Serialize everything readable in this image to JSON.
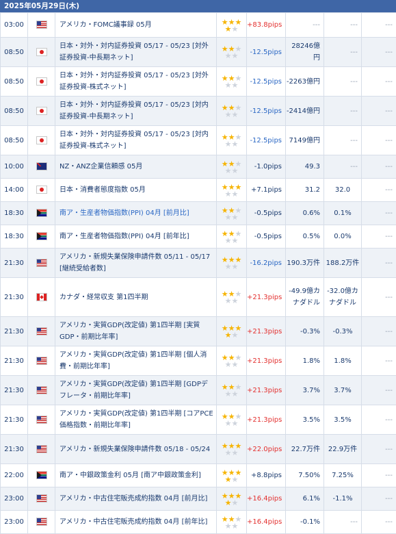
{
  "date_header": "2025年05月29日(木)",
  "rows": [
    {
      "time": "03:00",
      "flag": "us",
      "event": "アメリカ・FOMC議事録 05月",
      "stars": 4,
      "pips": "+83.8pips",
      "pips_class": "pos",
      "prev": "---",
      "forecast": "---",
      "result": "---"
    },
    {
      "time": "08:50",
      "flag": "jp",
      "event": "日本・対外・対内証券投資 05/17 - 05/23 [対外証券投資-中長期ネット]",
      "stars": 2,
      "pips": "-12.5pips",
      "pips_class": "neg",
      "prev": "28246億円",
      "forecast": "---",
      "result": "---"
    },
    {
      "time": "08:50",
      "flag": "jp",
      "event": "日本・対外・対内証券投資 05/17 - 05/23 [対外証券投資-株式ネット]",
      "stars": 2,
      "pips": "-12.5pips",
      "pips_class": "neg",
      "prev": "-2263億円",
      "forecast": "---",
      "result": "---"
    },
    {
      "time": "08:50",
      "flag": "jp",
      "event": "日本・対外・対内証券投資 05/17 - 05/23 [対内証券投資-中長期ネット]",
      "stars": 2,
      "pips": "-12.5pips",
      "pips_class": "neg",
      "prev": "-2414億円",
      "forecast": "---",
      "result": "---"
    },
    {
      "time": "08:50",
      "flag": "jp",
      "event": "日本・対外・対内証券投資 05/17 - 05/23 [対内証券投資-株式ネット]",
      "stars": 2,
      "pips": "-12.5pips",
      "pips_class": "neg",
      "prev": "7149億円",
      "forecast": "---",
      "result": "---"
    },
    {
      "time": "10:00",
      "flag": "nz",
      "event": "NZ・ANZ企業信頼感 05月",
      "stars": 2,
      "pips": "-1.0pips",
      "pips_class": "zero",
      "prev": "49.3",
      "forecast": "---",
      "result": "---"
    },
    {
      "time": "14:00",
      "flag": "jp",
      "event": "日本・消費者態度指数 05月",
      "stars": 3,
      "pips": "+7.1pips",
      "pips_class": "zero",
      "prev": "31.2",
      "forecast": "32.0",
      "result": "---"
    },
    {
      "time": "18:30",
      "flag": "za",
      "event": "南ア・生産者物価指数(PPI) 04月 [前月比]",
      "stars": 2,
      "pips": "-0.5pips",
      "pips_class": "zero",
      "prev": "0.6%",
      "forecast": "0.1%",
      "result": "---",
      "highlight": true
    },
    {
      "time": "18:30",
      "flag": "za",
      "event": "南ア・生産者物価指数(PPI) 04月 [前年比]",
      "stars": 2,
      "pips": "-0.5pips",
      "pips_class": "zero",
      "prev": "0.5%",
      "forecast": "0.0%",
      "result": "---"
    },
    {
      "time": "21:30",
      "flag": "us",
      "event": "アメリカ・新規失業保険申請件数 05/11 - 05/17 [継続受給者数]",
      "stars": 3,
      "pips": "-16.2pips",
      "pips_class": "neg",
      "prev": "190.3万件",
      "forecast": "188.2万件",
      "result": "---"
    },
    {
      "time": "21:30",
      "flag": "ca",
      "event": "カナダ・経常収支 第1四半期",
      "stars": 2,
      "pips": "+21.3pips",
      "pips_class": "pos",
      "prev": "-49.9億カナダドル",
      "forecast": "-32.0億カナダドル",
      "result": "---"
    },
    {
      "time": "21:30",
      "flag": "us",
      "event": "アメリカ・実質GDP(改定値) 第1四半期 [実質GDP・前期比年率]",
      "stars": 4,
      "pips": "+21.3pips",
      "pips_class": "pos",
      "prev": "-0.3%",
      "forecast": "-0.3%",
      "result": "---"
    },
    {
      "time": "21:30",
      "flag": "us",
      "event": "アメリカ・実質GDP(改定値) 第1四半期 [個人消費・前期比年率]",
      "stars": 2,
      "pips": "+21.3pips",
      "pips_class": "pos",
      "prev": "1.8%",
      "forecast": "1.8%",
      "result": "---"
    },
    {
      "time": "21:30",
      "flag": "us",
      "event": "アメリカ・実質GDP(改定値) 第1四半期 [GDPデフレータ・前期比年率]",
      "stars": 2,
      "pips": "+21.3pips",
      "pips_class": "pos",
      "prev": "3.7%",
      "forecast": "3.7%",
      "result": "---"
    },
    {
      "time": "21:30",
      "flag": "us",
      "event": "アメリカ・実質GDP(改定値) 第1四半期 [コアPCE価格指数・前期比年率]",
      "stars": 2,
      "pips": "+21.3pips",
      "pips_class": "pos",
      "prev": "3.5%",
      "forecast": "3.5%",
      "result": "---"
    },
    {
      "time": "21:30",
      "flag": "us",
      "event": "アメリカ・新規失業保険申請件数 05/18 - 05/24",
      "stars": 3,
      "pips": "+22.0pips",
      "pips_class": "pos",
      "prev": "22.7万件",
      "forecast": "22.9万件",
      "result": "---"
    },
    {
      "time": "22:00",
      "flag": "za",
      "event": "南ア・中銀政策金利 05月 [南ア中銀政策金利]",
      "stars": 4,
      "pips": "+8.8pips",
      "pips_class": "zero",
      "prev": "7.50%",
      "forecast": "7.25%",
      "result": "---"
    },
    {
      "time": "23:00",
      "flag": "us",
      "event": "アメリカ・中古住宅販売成約指数 04月 [前月比]",
      "stars": 4,
      "pips": "+16.4pips",
      "pips_class": "pos",
      "prev": "6.1%",
      "forecast": "-1.1%",
      "result": "---"
    },
    {
      "time": "23:00",
      "flag": "us",
      "event": "アメリカ・中古住宅販売成約指数 04月 [前年比]",
      "stars": 2,
      "pips": "+16.4pips",
      "pips_class": "pos",
      "prev": "-0.1%",
      "forecast": "---",
      "result": "---"
    }
  ]
}
